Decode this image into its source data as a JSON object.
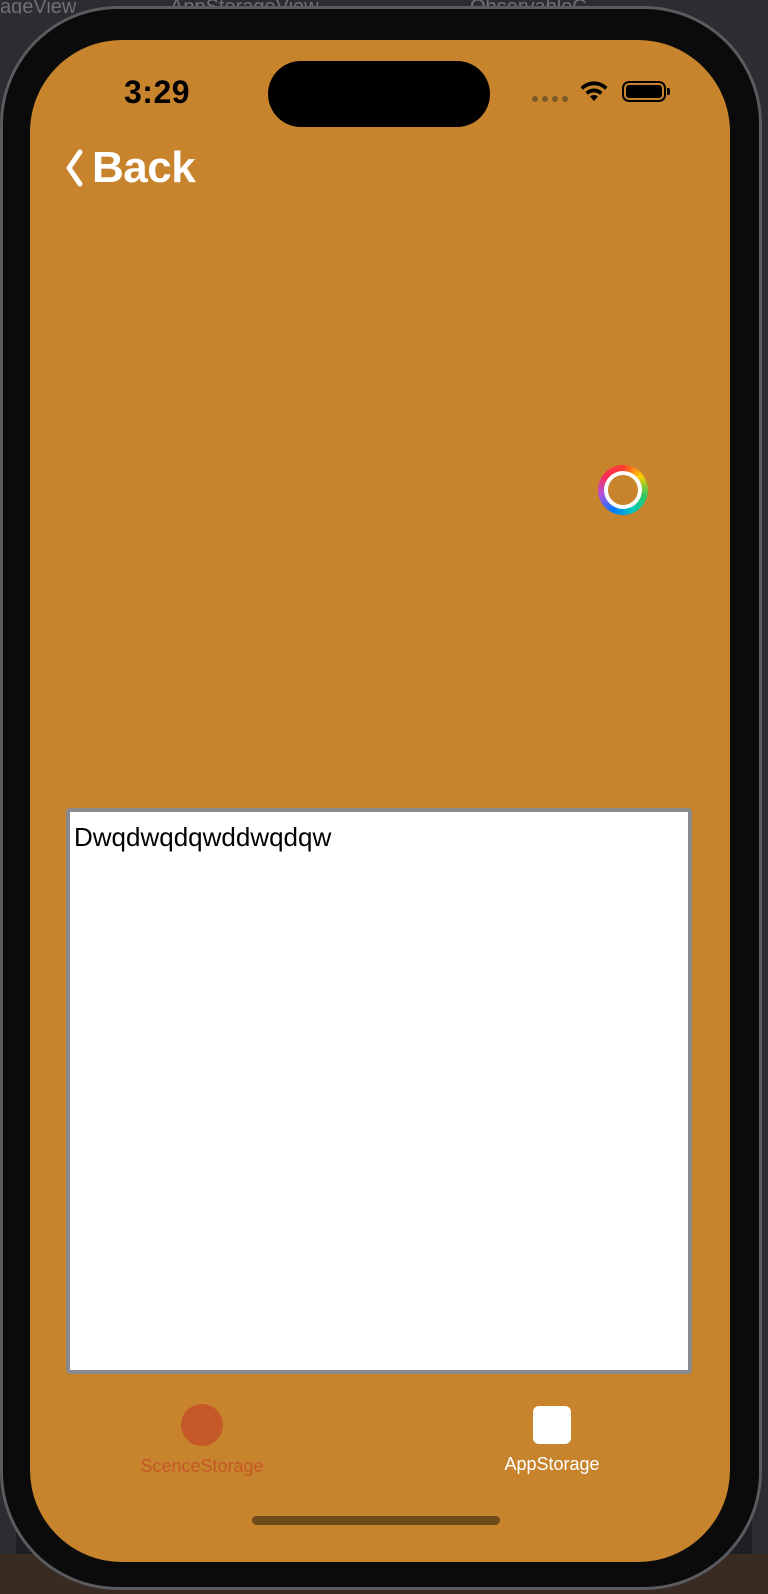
{
  "xcode": {
    "tabs": [
      "ageView",
      "AppStorageView",
      "ObservableC..."
    ]
  },
  "status_bar": {
    "time": "3:29"
  },
  "nav": {
    "back_label": "Back"
  },
  "editor": {
    "text": "Dwqdwqdqwddwqdqw"
  },
  "tab_bar": {
    "items": [
      {
        "label": "ScenceStorage",
        "icon": "circle-icon",
        "selected": true
      },
      {
        "label": "AppStorage",
        "icon": "square-icon",
        "selected": false
      }
    ]
  },
  "colors": {
    "background": "#c7842d",
    "selected_tab": "#c45827",
    "unselected_tab": "#ffffff",
    "editor_border": "#8a8a8e"
  }
}
